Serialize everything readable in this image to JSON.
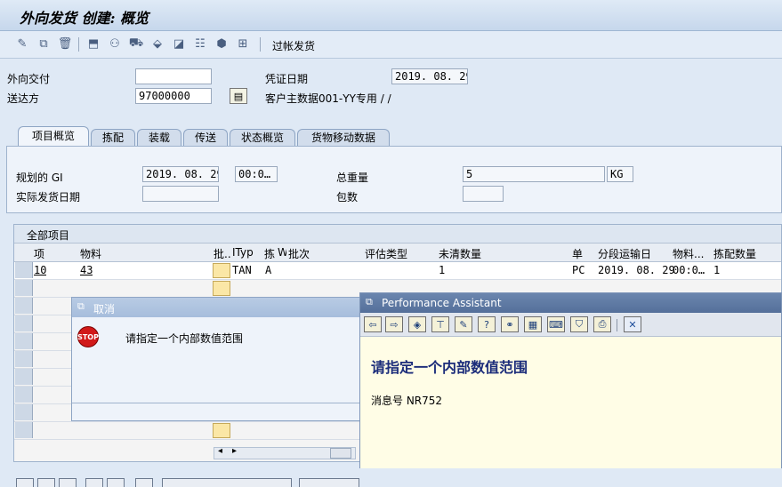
{
  "window": {
    "title": "外向发货 创建: 概览"
  },
  "toolbar": {
    "button_label": "过帐发货"
  },
  "header": {
    "delivery_label": "外向交付",
    "delivery_value": "",
    "ship_to_label": "送达方",
    "ship_to_value": "97000000",
    "doc_date_label": "凭证日期",
    "doc_date_value": "2019. 08. 29",
    "customer_text": "客户主数据001-YY专用 / /"
  },
  "tabs": [
    {
      "label": "项目概览"
    },
    {
      "label": "拣配"
    },
    {
      "label": "装载"
    },
    {
      "label": "传送"
    },
    {
      "label": "状态概览"
    },
    {
      "label": "货物移动数据"
    }
  ],
  "panel": {
    "planned_gi_label": "规划的 GI",
    "planned_gi_date": "2019. 08. 29",
    "planned_gi_time": "00:0…",
    "actual_gi_label": "实际发货日期",
    "actual_gi_value": "",
    "total_weight_label": "总重量",
    "total_weight_value": "5",
    "weight_unit": "KG",
    "packages_label": "包数",
    "packages_value": ""
  },
  "grid": {
    "title": "全部项目",
    "columns": [
      "项",
      "物料",
      "批..",
      "ITyp",
      "拣",
      "W",
      "批次",
      "评估类型",
      "未清数量",
      "单",
      "分段运输日",
      "物料...",
      "拣配数量"
    ],
    "rows": [
      {
        "item": "10",
        "material": "43",
        "itype": "TAN",
        "pick": "A",
        "open_qty": "1",
        "unit": "PC",
        "date": "2019. 08. 29",
        "time": "00:0…",
        "pick_qty": "1"
      }
    ]
  },
  "cancel_dialog": {
    "title": "取消",
    "message": "请指定一个内部数值范围",
    "icon": "stop-icon"
  },
  "perf_assistant": {
    "title": "Performance Assistant",
    "heading": "请指定一个内部数值范围",
    "message_no": "消息号 NR752"
  }
}
